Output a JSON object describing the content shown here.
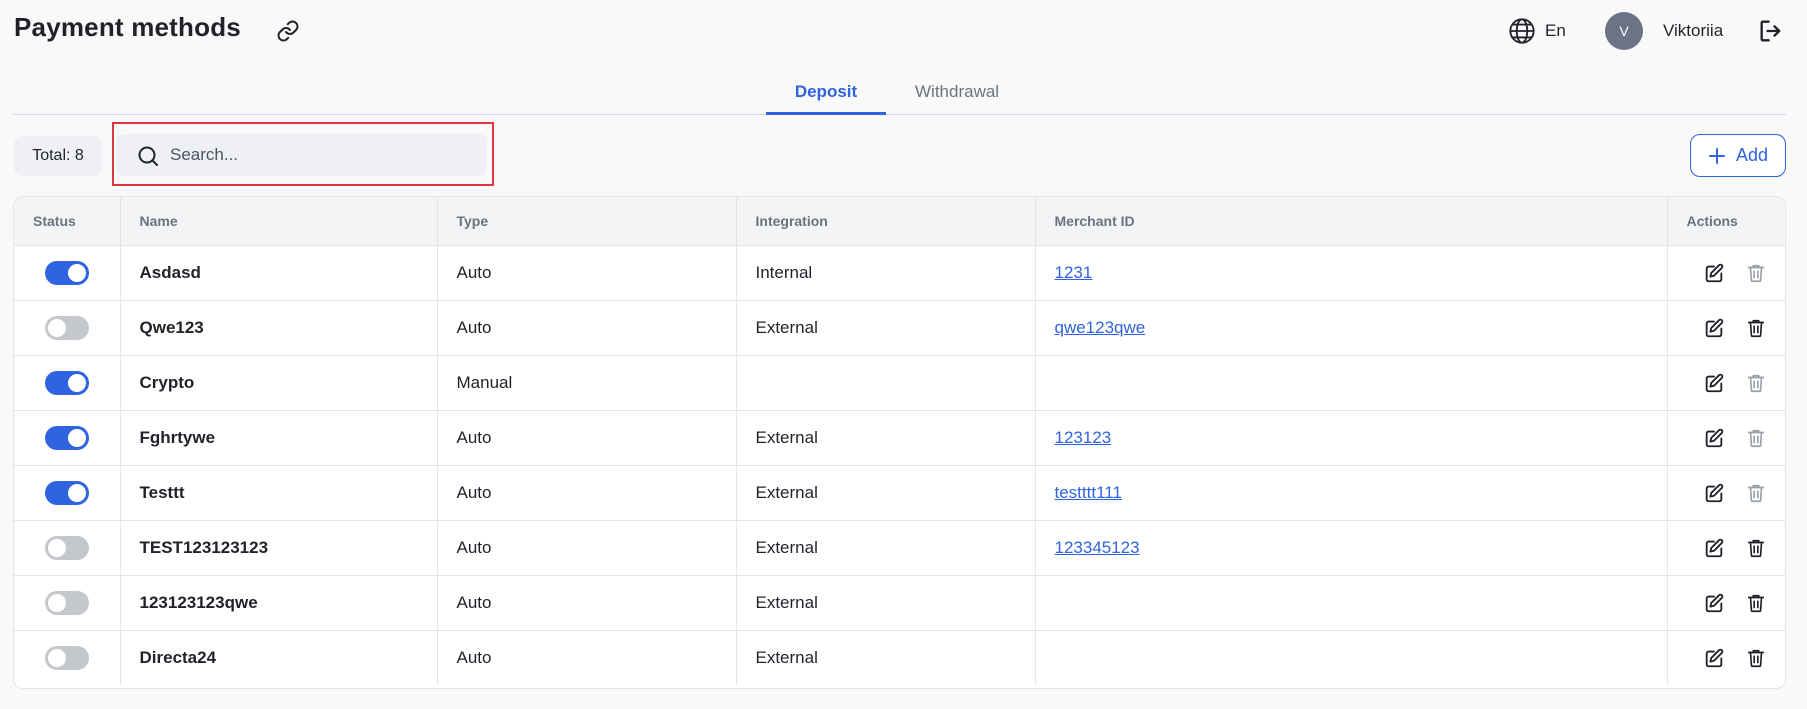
{
  "header": {
    "title": "Payment methods",
    "language": "En",
    "avatar_initial": "V",
    "username": "Viktoriia"
  },
  "tabs": [
    {
      "label": "Deposit",
      "active": true
    },
    {
      "label": "Withdrawal",
      "active": false
    }
  ],
  "toolbar": {
    "total_label": "Total: 8",
    "search_placeholder": "Search...",
    "add_label": "Add"
  },
  "table": {
    "columns": [
      "Status",
      "Name",
      "Type",
      "Integration",
      "Merchant ID",
      "Actions"
    ],
    "rows": [
      {
        "status": true,
        "name": "Asdasd",
        "type": "Auto",
        "integration": "Internal",
        "merchant_id": "1231",
        "delete_enabled": false
      },
      {
        "status": false,
        "name": "Qwe123",
        "type": "Auto",
        "integration": "External",
        "merchant_id": "qwe123qwe",
        "delete_enabled": true
      },
      {
        "status": true,
        "name": "Crypto",
        "type": "Manual",
        "integration": "",
        "merchant_id": "",
        "delete_enabled": false
      },
      {
        "status": true,
        "name": "Fghrtywe",
        "type": "Auto",
        "integration": "External",
        "merchant_id": "123123",
        "delete_enabled": false
      },
      {
        "status": true,
        "name": "Testtt",
        "type": "Auto",
        "integration": "External",
        "merchant_id": "testttt111",
        "delete_enabled": false
      },
      {
        "status": false,
        "name": "TEST123123123",
        "type": "Auto",
        "integration": "External",
        "merchant_id": "123345123",
        "delete_enabled": true
      },
      {
        "status": false,
        "name": "123123123qwe",
        "type": "Auto",
        "integration": "External",
        "merchant_id": "",
        "delete_enabled": true
      },
      {
        "status": false,
        "name": "Directa24",
        "type": "Auto",
        "integration": "External",
        "merchant_id": "",
        "delete_enabled": true
      }
    ]
  },
  "icons": {
    "share": "link-icon",
    "language": "globe-icon",
    "logout": "logout-icon",
    "search": "search-icon",
    "add": "plus-icon",
    "edit": "edit-icon",
    "delete": "trash-icon"
  },
  "colors": {
    "accent": "#2f63e0",
    "toggle_off": "#c4c7cc",
    "highlight": "#d9383f",
    "avatar_bg": "#6b7384"
  }
}
